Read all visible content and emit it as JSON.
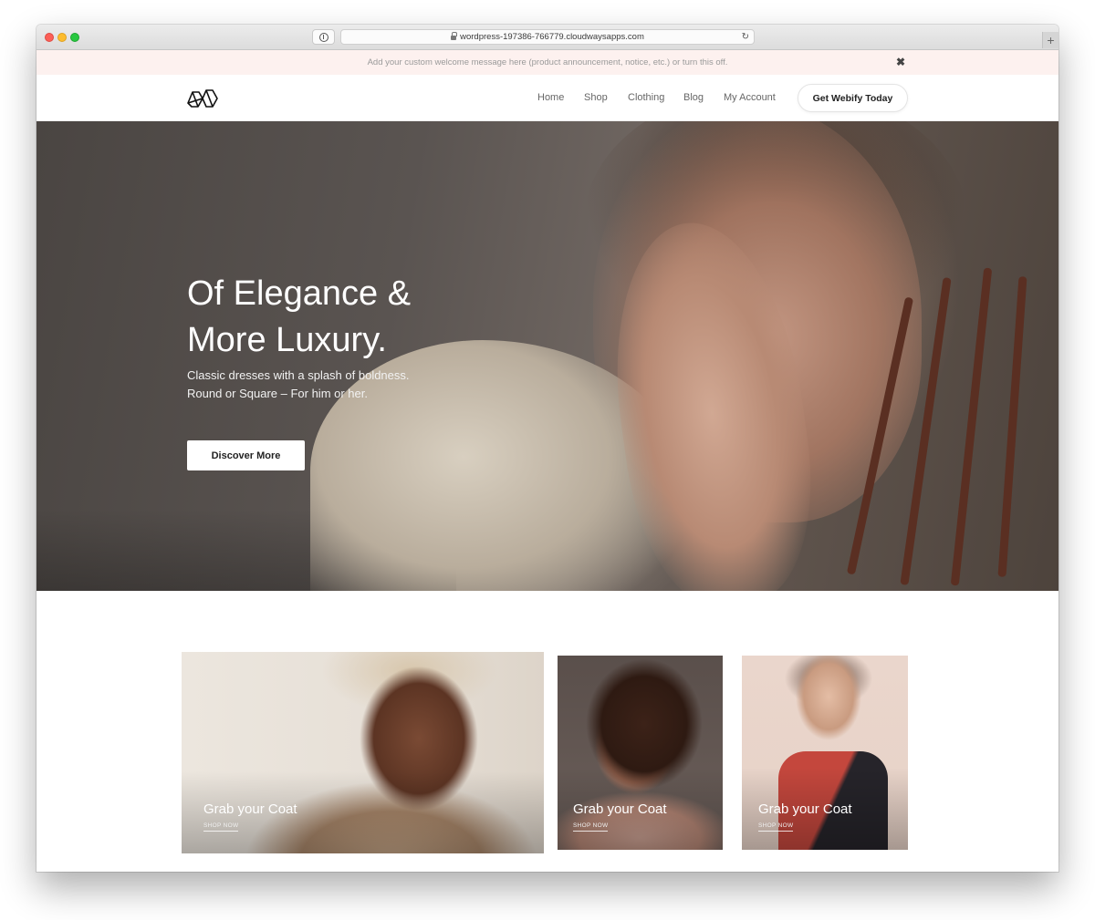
{
  "browser": {
    "url": "wordpress-197386-766779.cloudwaysapps.com"
  },
  "announcement": {
    "text": "Add your custom welcome message here (product announcement, notice, etc.) or turn this off.",
    "close_glyph": "✖"
  },
  "header": {
    "nav": [
      "Home",
      "Shop",
      "Clothing",
      "Blog",
      "My Account"
    ],
    "cta_label": "Get Webify Today"
  },
  "hero": {
    "title": "Of Elegance &\nMore Luxury.",
    "subtitle": "Classic dresses with a splash of boldness.\nRound or Square – For him or her.",
    "button_label": "Discover More"
  },
  "cards": [
    {
      "title": "Grab your Coat",
      "link": "SHOP NOW"
    },
    {
      "title": "Grab your Coat",
      "link": "SHOP NOW"
    },
    {
      "title": "Grab your Coat",
      "link": "SHOP NOW"
    }
  ],
  "colors": {
    "announcement_bg": "#fdf1ef",
    "accent_dress_red": "#c4473d"
  }
}
